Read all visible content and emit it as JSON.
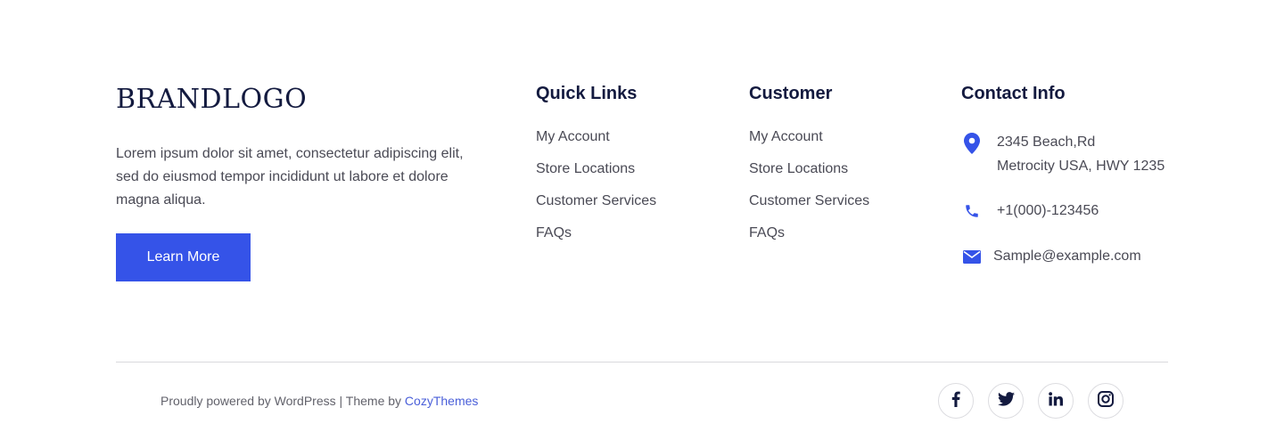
{
  "brand": {
    "logo_text": "BRANDLOGO",
    "description": "Lorem ipsum dolor sit amet, consectetur adipiscing elit, sed do eiusmod tempor incididunt ut labore et dolore magna aliqua.",
    "button_label": "Learn More"
  },
  "quick_links": {
    "title": "Quick Links",
    "items": [
      "My Account",
      "Store Locations",
      "Customer Services",
      "FAQs"
    ]
  },
  "customer": {
    "title": "Customer",
    "items": [
      "My Account",
      "Store Locations",
      "Customer Services",
      "FAQs"
    ]
  },
  "contact": {
    "title": "Contact Info",
    "address_line1": "2345 Beach,Rd",
    "address_line2": "Metrocity USA, HWY 1235",
    "phone": "+1(000)-123456",
    "email": "Sample@example.com"
  },
  "bottom": {
    "powered_text": "Proudly powered by WordPress",
    "separator": "|",
    "theme_prefix": "Theme by",
    "theme_link": "CozyThemes",
    "socials": [
      "facebook-icon",
      "twitter-icon",
      "linkedin-icon",
      "instagram-icon"
    ]
  },
  "colors": {
    "accent": "#3553e8",
    "heading": "#131a3f",
    "link": "#4a5fd9",
    "divider": "#d9d9dd"
  }
}
